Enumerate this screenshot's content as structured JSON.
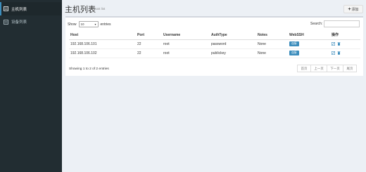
{
  "sidebar": {
    "items": [
      {
        "label": "主机列表",
        "icon": "list-icon",
        "active": true
      },
      {
        "label": "设备列表",
        "icon": "list-icon",
        "active": false
      }
    ]
  },
  "header": {
    "title": "主机列表",
    "subtitle": "host list",
    "add_label": "添加"
  },
  "table_controls": {
    "show_label": "Show",
    "length_value": "10",
    "entries_label": "entries",
    "search_label": "Search:"
  },
  "table": {
    "columns": [
      "Host",
      "Port",
      "Username",
      "AuthType",
      "Notes",
      "WebSSH",
      "操作"
    ],
    "rows": [
      {
        "host": "192.168.106.101",
        "port": "22",
        "username": "root",
        "authtype": "password",
        "notes": "None",
        "webssh": "连接"
      },
      {
        "host": "192.168.106.102",
        "port": "22",
        "username": "root",
        "authtype": "publickey",
        "notes": "None",
        "webssh": "连接"
      }
    ]
  },
  "footer": {
    "info": "Showing 1 to 2 of 2 entries",
    "pager": [
      "首页",
      "上一页",
      "下一页",
      "尾页"
    ]
  },
  "colors": {
    "sidebar": "#222d32",
    "accent": "#3c8dbc",
    "background": "#ecf0f5"
  }
}
